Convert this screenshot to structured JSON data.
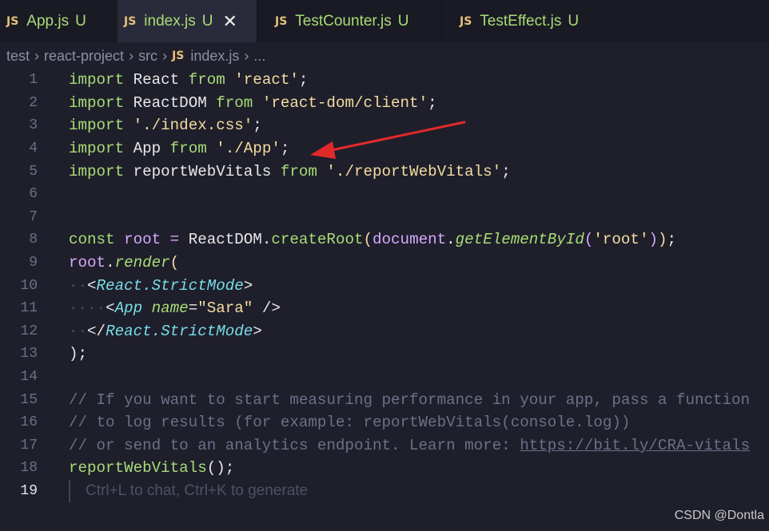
{
  "tabs": [
    {
      "badge": "JS",
      "name": "App.js",
      "status": "U",
      "active": false
    },
    {
      "badge": "JS",
      "name": "index.js",
      "status": "U",
      "active": true,
      "close": "✕"
    },
    {
      "badge": "JS",
      "name": "TestCounter.js",
      "status": "U",
      "active": false
    },
    {
      "badge": "JS",
      "name": "TestEffect.js",
      "status": "U",
      "active": false
    }
  ],
  "breadcrumb": {
    "items": [
      "test",
      "react-project",
      "src"
    ],
    "file_badge": "JS",
    "file": "index.js",
    "more": "...",
    "separator": "›"
  },
  "code": {
    "lines": [
      "1",
      "2",
      "3",
      "4",
      "5",
      "6",
      "7",
      "8",
      "9",
      "10",
      "11",
      "12",
      "13",
      "14",
      "15",
      "16",
      "17",
      "18",
      "19"
    ],
    "current_line": "19",
    "hint": "Ctrl+L to chat, Ctrl+K to generate",
    "l1": {
      "kw": "import",
      "id": " React ",
      "kw2": "from",
      "str": " 'react'",
      "end": ";"
    },
    "l2": {
      "kw": "import",
      "id": " ReactDOM ",
      "kw2": "from",
      "str": " 'react-dom/client'",
      "end": ";"
    },
    "l3": {
      "kw": "import",
      "str": " './index.css'",
      "end": ";"
    },
    "l4": {
      "kw": "import",
      "id": " App ",
      "kw2": "from",
      "str": " './App'",
      "end": ";"
    },
    "l5": {
      "kw": "import",
      "id": " reportWebVitals ",
      "kw2": "from",
      "str": " './reportWebVitals'",
      "end": ";"
    },
    "l8": {
      "kw": "const",
      "var": " root",
      "eq": " = ",
      "obj": "ReactDOM",
      "dot": ".",
      "fn": "createRoot",
      "p1": "(",
      "doc": "document",
      "dot2": ".",
      "fn2": "getElementById",
      "p2": "(",
      "str": "'root'",
      "p3": ")",
      "p4": ")",
      "end": ";"
    },
    "l9": {
      "var": "root",
      "dot": ".",
      "fn": "render",
      "p": "("
    },
    "l10": {
      "lt": "<",
      "tag": "React.StrictMode",
      "gt": ">"
    },
    "l11": {
      "lt": "<",
      "tag": "App",
      "attr": " name",
      "eq": "=",
      "str": "\"Sara\"",
      "close": " />"
    },
    "l12": {
      "lt": "</",
      "tag": "React.StrictMode",
      "gt": ">"
    },
    "l13": {
      "text": ");"
    },
    "l15": {
      "text": "// If you want to start measuring performance in your app, pass a function"
    },
    "l16": {
      "text": "// to log results (for example: reportWebVitals(console.log))"
    },
    "l17": {
      "text": "// or send to an analytics endpoint. Learn more: ",
      "link": "https://bit.ly/CRA-vitals"
    },
    "l18": {
      "fn": "reportWebVitals",
      "p": "()",
      "end": ";"
    }
  },
  "annotation": {
    "color": "#e02a2a",
    "target_line": "4"
  },
  "watermark": "CSDN @Dontla",
  "colors": {
    "background": "#1e1f2b",
    "tabbar": "#1a1a24",
    "active_tab": "#2a2b3a",
    "keyword": "#a9dc76",
    "string": "#f5dca0"
  }
}
